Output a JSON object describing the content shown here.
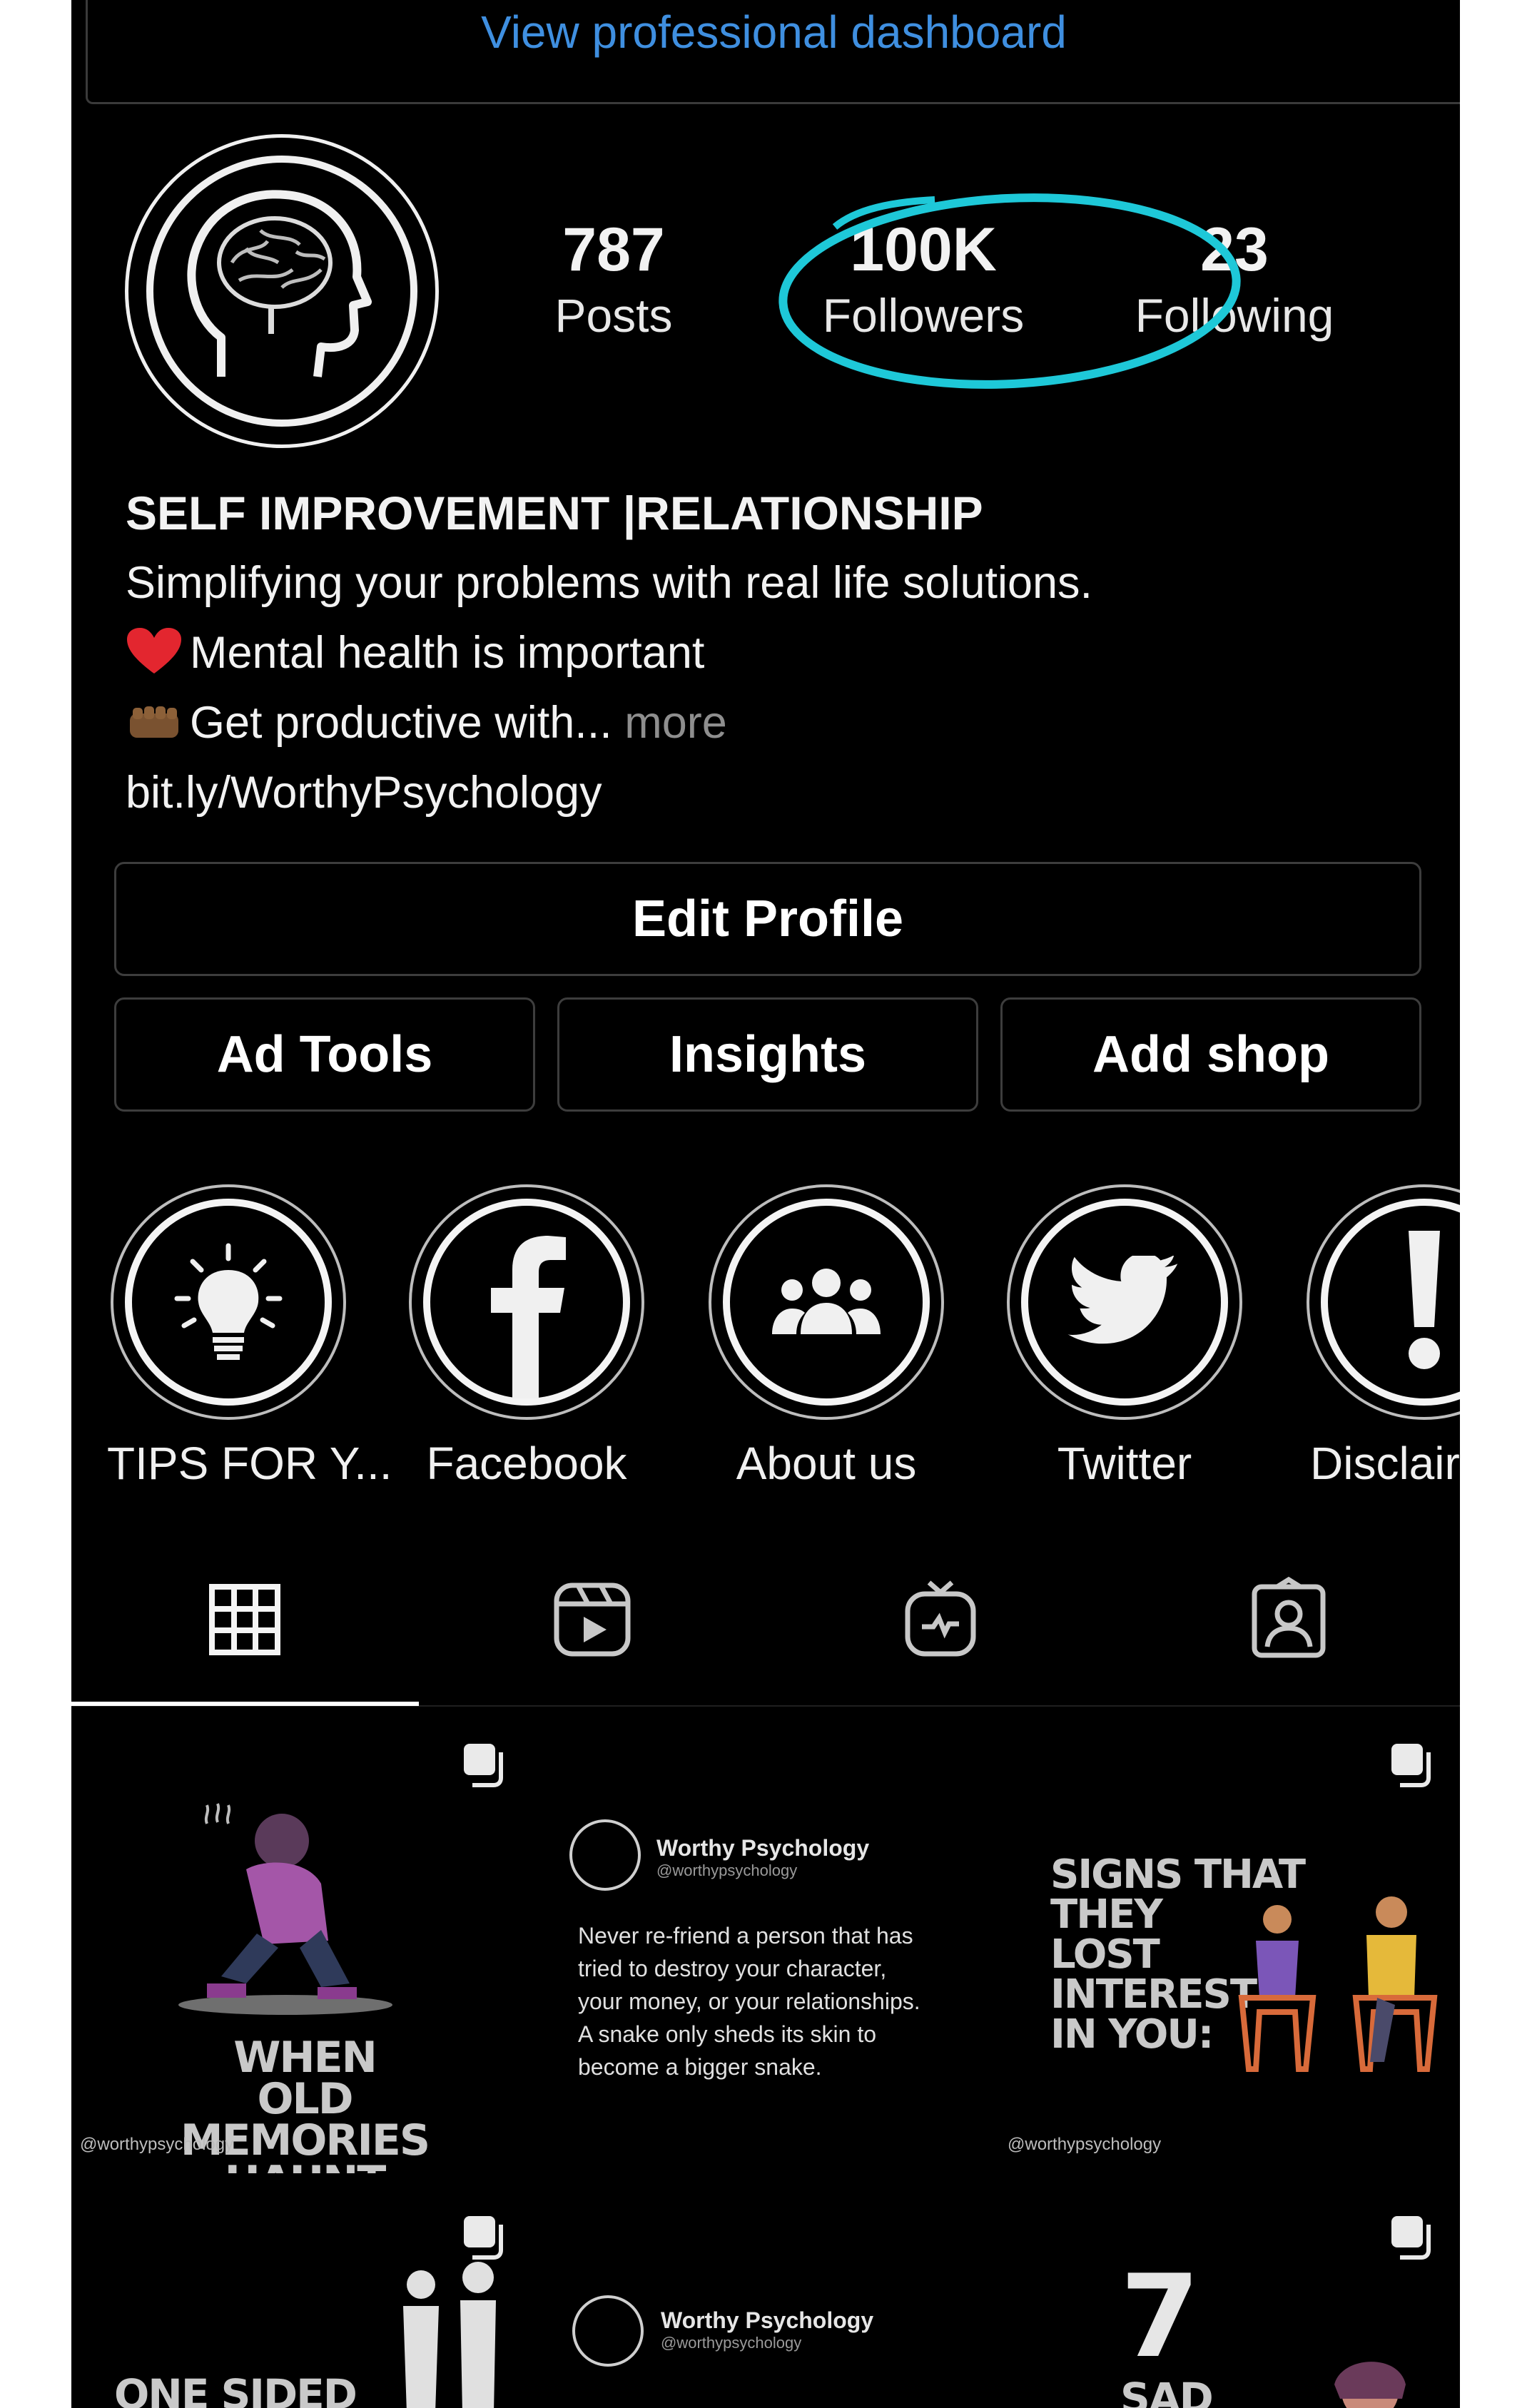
{
  "header": {
    "dashboard_link": "View professional dashboard"
  },
  "profile": {
    "stats": [
      {
        "value": "787",
        "label": "Posts"
      },
      {
        "value": "100K",
        "label": "Followers"
      },
      {
        "value": "23",
        "label": "Following"
      }
    ],
    "bio": {
      "name": "SELF IMPROVEMENT |RELATIONSHIP",
      "line1": "Simplifying your problems with real life solutions.",
      "line2": "Mental health is important",
      "line3": "Get productive with...",
      "more": "more",
      "link": "bit.ly/WorthyPsychology"
    },
    "highlight_color": "#1ec8d8"
  },
  "buttons": {
    "edit_profile": "Edit Profile",
    "ad_tools": "Ad Tools",
    "insights": "Insights",
    "add_shop": "Add shop"
  },
  "highlights": [
    {
      "label": "TIPS FOR Y...",
      "icon": "lightbulb-icon"
    },
    {
      "label": "Facebook",
      "icon": "facebook-icon"
    },
    {
      "label": "About us",
      "icon": "group-icon"
    },
    {
      "label": "Twitter",
      "icon": "twitter-icon"
    },
    {
      "label": "Disclair",
      "icon": "exclamation-icon"
    }
  ],
  "tabs": [
    "grid-icon",
    "reels-icon",
    "igtv-icon",
    "tagged-icon"
  ],
  "posts": {
    "p1": {
      "title_a": "WHEN OLD",
      "title_b": "MEMORIES",
      "title_c": "HAUNT YOU...",
      "handle": "@worthypsychology"
    },
    "p2": {
      "name": "Worthy Psychology",
      "handle": "@worthypsychology",
      "quote": [
        "Never re-friend a person that has",
        "tried to destroy your character,",
        "your money, or your relationships.",
        "A snake only sheds its skin to",
        "become a bigger snake."
      ]
    },
    "p3": {
      "lines": [
        "SIGNS THAT",
        "THEY",
        "LOST",
        "INTEREST",
        "IN YOU:"
      ],
      "handle": "@worthypsychology"
    },
    "p4": {
      "title": "ONE SIDED"
    },
    "p5": {
      "name": "Worthy Psychology",
      "handle": "@worthypsychology"
    },
    "p6": {
      "number": "7",
      "word": "SAD"
    }
  }
}
